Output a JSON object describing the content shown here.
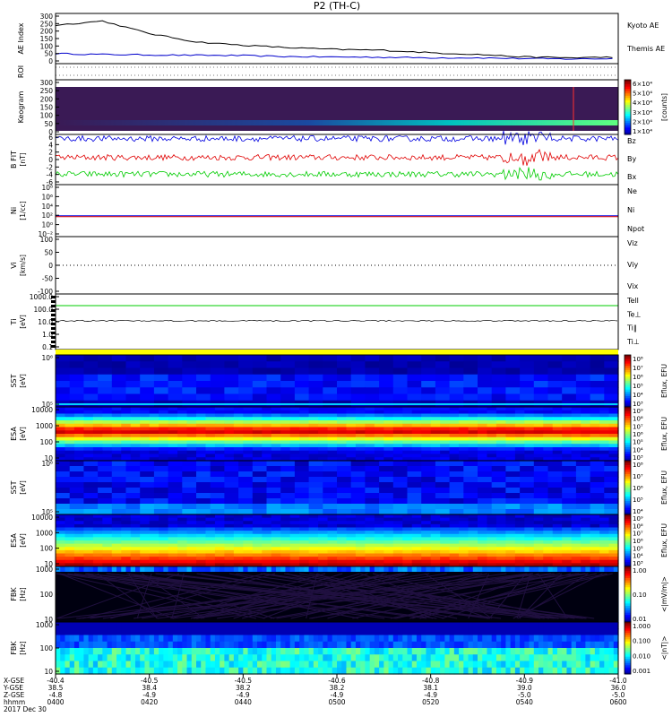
{
  "title": "P2 (TH-C)",
  "colors": {
    "frame": "#000000",
    "kyoto": "#0000cc",
    "themis": "#000000",
    "red": "#e00000",
    "green": "#00cc00",
    "blue": "#0000e0",
    "yellow": "#ffff00",
    "dark_bg": "#1a0a2a"
  },
  "chart_data": [
    {
      "type": "line",
      "panel": "ae-index",
      "ylabel": "AE Index",
      "yunit": "",
      "ylim": [
        0,
        300
      ],
      "yticks": [
        "300",
        "250",
        "200",
        "150",
        "100",
        "50",
        "0"
      ],
      "x": [
        0,
        10,
        20,
        30,
        40,
        50,
        60,
        70,
        80,
        90,
        100,
        110,
        120
      ],
      "series": [
        {
          "name": "Kyoto AE",
          "color": "#0000cc",
          "values": [
            60,
            55,
            52,
            50,
            48,
            42,
            40,
            38,
            35,
            35,
            30,
            28,
            30
          ]
        },
        {
          "name": "Themis AE",
          "color": "#000000",
          "values": [
            230,
            255,
            180,
            130,
            110,
            95,
            85,
            80,
            65,
            55,
            40,
            35,
            40
          ]
        }
      ]
    },
    {
      "type": "heatmap",
      "panel": "roi",
      "ylabel": "ROI",
      "values": []
    },
    {
      "type": "heatmap",
      "panel": "keogram",
      "ylabel": "Keogram",
      "ylim": [
        0,
        300
      ],
      "yticks": [
        "300",
        "250",
        "200",
        "150",
        "100",
        "50",
        "0"
      ],
      "colorbar": {
        "ticks": [
          "6×10⁴",
          "5×10⁴",
          "4×10⁴",
          "3×10⁴",
          "2×10⁴",
          "1×10⁴"
        ],
        "label": "[counts]"
      }
    },
    {
      "type": "line",
      "panel": "b-fgl",
      "ylabel": "B FIT",
      "yunit": "[nT]",
      "ylim": [
        -6,
        6
      ],
      "yticks": [
        "6",
        "4",
        "2",
        "0",
        "-2",
        "-4",
        "-6"
      ],
      "series": [
        {
          "name": "Bz",
          "color": "#e00000",
          "level": 0.5
        },
        {
          "name": "By",
          "color": "#00cc00",
          "level": -3.5
        },
        {
          "name": "Bx",
          "color": "#0000e0",
          "level": 5.0
        }
      ]
    },
    {
      "type": "line",
      "panel": "density",
      "ylabel": "Ni",
      "yunit": "[1/cc]",
      "yticks": [
        "10⁸",
        "10⁶",
        "10⁴",
        "10²",
        "10⁰",
        "10⁻²"
      ],
      "series": [
        {
          "name": "Ne",
          "color": "#e00000",
          "level": 1
        },
        {
          "name": "Ni",
          "color": "#000000",
          "level": 1
        },
        {
          "name": "Npot",
          "color": "#0000e0",
          "level": 1
        }
      ]
    },
    {
      "type": "line",
      "panel": "velocity",
      "ylabel": "Vi",
      "yunit": "[km/s]",
      "yticks": [
        "100",
        "50",
        "0",
        "-50",
        "-100"
      ],
      "series": [
        {
          "name": "Viz",
          "color": "#e00000",
          "level": 0
        },
        {
          "name": "Viy",
          "color": "#00cc00",
          "level": 0
        },
        {
          "name": "Vix",
          "color": "#0000e0",
          "level": 0
        }
      ]
    },
    {
      "type": "line",
      "panel": "temperature",
      "ylabel": "Ti",
      "yunit": "[eV]",
      "yticks": [
        "1000.0",
        "100.0",
        "10.0",
        "1.0",
        "0.1"
      ],
      "series": [
        {
          "name": "Tell",
          "color": "#000000"
        },
        {
          "name": "Te⊥",
          "color": "#e00000"
        },
        {
          "name": "Ti‖",
          "color": "#00cc00"
        },
        {
          "name": "Ti⊥",
          "color": "#0000e0"
        }
      ]
    },
    {
      "type": "heatmap",
      "panel": "sst-e",
      "ylabel": "SST",
      "yunit": "[eV]",
      "yticks": [
        "10⁶",
        "10⁵"
      ],
      "colorbar": {
        "ticks": [
          "10⁸",
          "10⁷",
          "10⁶",
          "10⁵",
          "10⁴",
          "10³"
        ],
        "label": "Eflux, EFU"
      }
    },
    {
      "type": "heatmap",
      "panel": "esa-e",
      "ylabel": "ESA",
      "yunit": "[eV]",
      "yticks": [
        "10000",
        "1000",
        "100",
        "10"
      ],
      "colorbar": {
        "ticks": [
          "10⁹",
          "10⁸",
          "10⁷",
          "10⁶",
          "10⁵",
          "10⁴",
          "10³"
        ],
        "label": "Eflux, EFU"
      }
    },
    {
      "type": "heatmap",
      "panel": "sst-i",
      "ylabel": "SST",
      "yunit": "[eV]",
      "yticks": [
        "10⁶",
        "10⁵"
      ],
      "colorbar": {
        "ticks": [
          "10⁸",
          "10⁷",
          "10⁶",
          "10⁵",
          "10⁴"
        ],
        "label": "Eflux, EFU"
      }
    },
    {
      "type": "heatmap",
      "panel": "esa-i",
      "ylabel": "ESA",
      "yunit": "[eV]",
      "yticks": [
        "10000",
        "1000",
        "100",
        "10"
      ],
      "colorbar": {
        "ticks": [
          "10⁹",
          "10⁸",
          "10⁷",
          "10⁶",
          "10⁵",
          "10⁴",
          "10³"
        ],
        "label": "Eflux, EFU"
      }
    },
    {
      "type": "heatmap",
      "panel": "fbk-e",
      "ylabel": "FBK",
      "yunit": "[Hz]",
      "yticks": [
        "1000",
        "100",
        "10"
      ],
      "colorbar": {
        "ticks": [
          "1.00",
          "0.10",
          "0.01"
        ],
        "label": "<|mV/m|>"
      }
    },
    {
      "type": "heatmap",
      "panel": "fbk-b",
      "ylabel": "FBK",
      "yunit": "[Hz]",
      "yticks": [
        "1000",
        "100",
        "10"
      ],
      "colorbar": {
        "ticks": [
          "1.000",
          "0.100",
          "0.010",
          "0.001"
        ],
        "label": "<|nT|>"
      }
    }
  ],
  "x_axis": {
    "row_labels": [
      "X-GSE",
      "Y-GSE",
      "Z-GSE",
      "hhmm",
      "2017 Dec 30"
    ],
    "ticks": [
      {
        "x": "-40.4",
        "y": "38.5",
        "z": "-4.8",
        "time": "0400"
      },
      {
        "x": "-40.5",
        "y": "38.4",
        "z": "-4.9",
        "time": "0420"
      },
      {
        "x": "-40.5",
        "y": "38.2",
        "z": "-4.9",
        "time": "0440"
      },
      {
        "x": "-40.6",
        "y": "38.2",
        "z": "-4.9",
        "time": "0500"
      },
      {
        "x": "-40.8",
        "y": "38.1",
        "z": "-4.9",
        "time": "0520"
      },
      {
        "x": "-40.9",
        "y": "39.0",
        "z": "-5.0",
        "time": "0540"
      },
      {
        "x": "-41.0",
        "y": "36.0",
        "z": "-5.0",
        "time": "0600"
      }
    ]
  }
}
